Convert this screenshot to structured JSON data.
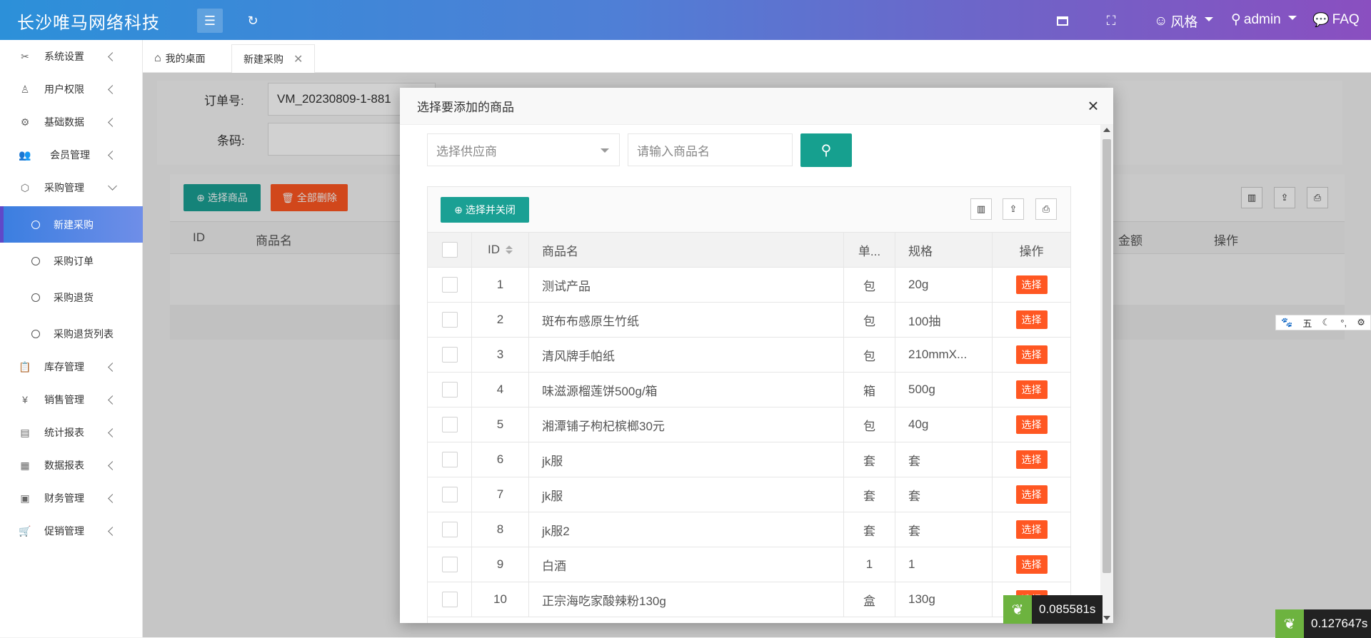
{
  "header": {
    "logo": "长沙唯马网络科技",
    "style_label": "风格",
    "user_label": "admin",
    "faq_label": "FAQ"
  },
  "sidebar": {
    "items": [
      {
        "label": "系统设置",
        "icon": "tools-icon"
      },
      {
        "label": "用户权限",
        "icon": "user-icon"
      },
      {
        "label": "基础数据",
        "icon": "gear-icon"
      },
      {
        "label": "会员管理",
        "icon": "users-icon"
      },
      {
        "label": "采购管理",
        "icon": "cube-icon"
      },
      {
        "label": "库存管理",
        "icon": "clipboard-icon"
      },
      {
        "label": "销售管理",
        "icon": "yen-icon"
      },
      {
        "label": "统计报表",
        "icon": "presentation-icon"
      },
      {
        "label": "数据报表",
        "icon": "table-icon"
      },
      {
        "label": "财务管理",
        "icon": "wallet-icon"
      },
      {
        "label": "促销管理",
        "icon": "cart-icon"
      }
    ],
    "sub_items": [
      "新建采购",
      "采购订单",
      "采购退货",
      "采购退货列表"
    ]
  },
  "tabs": {
    "home": "我的桌面",
    "current": "新建采购"
  },
  "main": {
    "order_label": "订单号:",
    "order_value": "VM_20230809-1-881",
    "barcode_label": "条码:",
    "select_goods_btn": "选择商品",
    "delete_all_btn": "全部删除",
    "columns": [
      "ID",
      "商品名",
      "金额",
      "操作"
    ]
  },
  "modal": {
    "title": "选择要添加的商品",
    "supplier_placeholder": "选择供应商",
    "goods_placeholder": "请输入商品名",
    "select_close_btn": "选择并关闭",
    "columns": [
      "ID",
      "商品名",
      "单...",
      "规格",
      "操作"
    ],
    "select_label": "选择",
    "rows": [
      {
        "id": "1",
        "name": "测试产品",
        "unit": "包",
        "spec": "20g"
      },
      {
        "id": "2",
        "name": "斑布布感原生竹纸",
        "unit": "包",
        "spec": "100抽"
      },
      {
        "id": "3",
        "name": "清风牌手帕纸",
        "unit": "包",
        "spec": "210mmX..."
      },
      {
        "id": "4",
        "name": "味滋源榴莲饼500g/箱",
        "unit": "箱",
        "spec": "500g"
      },
      {
        "id": "5",
        "name": "湘潭铺子枸杞槟榔30元",
        "unit": "包",
        "spec": "40g"
      },
      {
        "id": "6",
        "name": "jk服",
        "unit": "套",
        "spec": "套"
      },
      {
        "id": "7",
        "name": "jk服",
        "unit": "套",
        "spec": "套"
      },
      {
        "id": "8",
        "name": "jk服2",
        "unit": "套",
        "spec": "套"
      },
      {
        "id": "9",
        "name": "白酒",
        "unit": "1",
        "spec": "1"
      },
      {
        "id": "10",
        "name": "正宗海吃家酸辣粉130g",
        "unit": "盒",
        "spec": "130g"
      }
    ]
  },
  "timers": {
    "modal_timer": "0.085581s",
    "page_timer": "0.127647s"
  },
  "ime": {
    "label": "五"
  }
}
